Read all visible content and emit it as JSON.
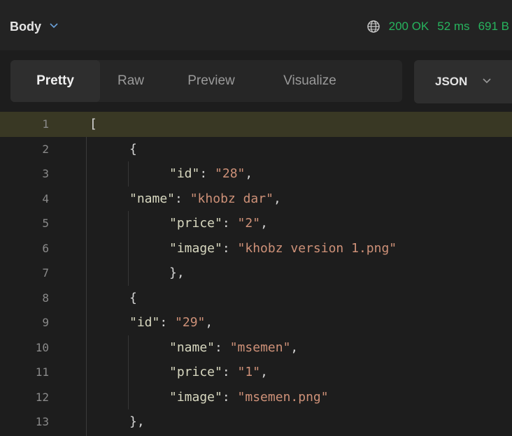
{
  "response": {
    "body_label": "Body",
    "status": "200 OK",
    "time": "52 ms",
    "size": "691 B"
  },
  "tabs": [
    {
      "label": "Pretty",
      "active": true
    },
    {
      "label": "Raw",
      "active": false
    },
    {
      "label": "Preview",
      "active": false
    },
    {
      "label": "Visualize",
      "active": false
    }
  ],
  "format": {
    "label": "JSON"
  },
  "code_lines": [
    {
      "n": "1",
      "text": "["
    },
    {
      "n": "2",
      "text": "{"
    },
    {
      "n": "3",
      "text": "\"id\": \"28\","
    },
    {
      "n": "4",
      "text": "\"name\": \"khobz dar\","
    },
    {
      "n": "5",
      "text": "\"price\": \"2\","
    },
    {
      "n": "6",
      "text": "\"image\": \"khobz version 1.png\""
    },
    {
      "n": "7",
      "text": "},"
    },
    {
      "n": "8",
      "text": "{"
    },
    {
      "n": "9",
      "text": "\"id\": \"29\","
    },
    {
      "n": "10",
      "text": "\"name\": \"msemen\","
    },
    {
      "n": "11",
      "text": "\"price\": \"1\","
    },
    {
      "n": "12",
      "text": "\"image\": \"msemen.png\""
    },
    {
      "n": "13",
      "text": "},"
    }
  ],
  "colors": {
    "status_green": "#27b45e",
    "json_key": "#9cdcfe",
    "json_string": "#ce9178"
  }
}
